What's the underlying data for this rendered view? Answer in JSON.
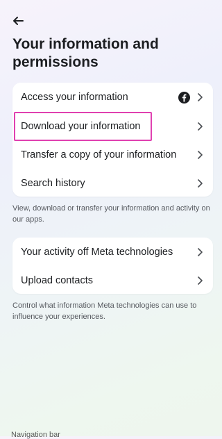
{
  "header": {
    "back_label": "Back",
    "title": "Your information and permissions"
  },
  "section1": {
    "items": [
      {
        "label": "Access your information",
        "icon": "facebook-icon"
      },
      {
        "label": "Download your information"
      },
      {
        "label": "Transfer a copy of your information"
      },
      {
        "label": "Search history"
      }
    ],
    "description": "View, download or transfer your information and activity on our apps."
  },
  "section2": {
    "items": [
      {
        "label": "Your activity off Meta technologies"
      },
      {
        "label": "Upload contacts"
      }
    ],
    "description": "Control what information Meta technologies can use to influence your experiences."
  },
  "footer": {
    "nav_label": "Navigation bar"
  },
  "colors": {
    "highlight": "#e040b0",
    "facebook": "#1c1e21",
    "card": "#ffffff"
  }
}
